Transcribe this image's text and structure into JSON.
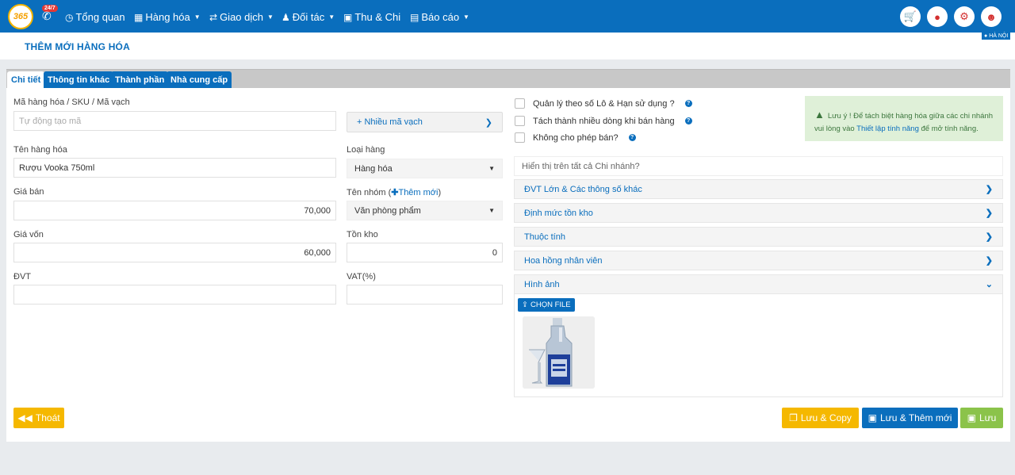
{
  "nav": {
    "logo_text": "365",
    "badge_text": "24/7",
    "items": [
      {
        "label": "Tổng quan",
        "icon": "dashboard-icon"
      },
      {
        "label": "Hàng hóa",
        "icon": "cubes-icon"
      },
      {
        "label": "Giao dịch",
        "icon": "exchange-icon"
      },
      {
        "label": "Đối tác",
        "icon": "users-icon"
      },
      {
        "label": "Thu & Chi",
        "icon": "money-icon"
      },
      {
        "label": "Báo cáo",
        "icon": "bar-chart-icon"
      }
    ],
    "right_icons": [
      "cart-icon",
      "map-marker-icon",
      "gear-icon",
      "user-icon"
    ]
  },
  "page": {
    "title": "THÊM MỚI HÀNG HÓA",
    "branch": "HÀ NỘI"
  },
  "tabs": [
    "Chi tiết",
    "Thông tin khác",
    "Thành phần",
    "Nhà cung cấp"
  ],
  "form": {
    "sku_label": "Mã hàng hóa / SKU / Mã vạch",
    "sku_placeholder": "Tự động tạo mã",
    "multi_barcode": "+ Nhiều mã vạch",
    "name_label": "Tên hàng hóa",
    "name_value": "Rượu Vooka 750ml",
    "type_label": "Loại hàng",
    "type_value": "Hàng hóa",
    "price_label": "Giá bán",
    "price_value": "70,000",
    "group_label": "Tên nhóm (",
    "group_add": "Thêm mới",
    "group_label_end": ")",
    "group_value": "Văn phòng phẩm",
    "cost_label": "Giá vốn",
    "cost_value": "60,000",
    "stock_label": "Tồn kho",
    "stock_value": "0",
    "unit_label": "ĐVT",
    "unit_value": "",
    "vat_label": "VAT(%)",
    "vat_value": ""
  },
  "options": {
    "lot": "Quản lý theo số Lô & Hạn sử dụng ?",
    "split": "Tách thành nhiều dòng khi bán hàng",
    "no_sell": "Không cho phép bán?",
    "show_all": "Hiển thị trên tất cả Chi nhánh?"
  },
  "note": {
    "text1": "Lưu ý ! Để tách biệt hàng hóa giữa các chi nhánh",
    "text2": "vui lòng vào ",
    "link": "Thiết lập tính năng",
    "text3": " để mở tính năng."
  },
  "accordion": [
    "ĐVT Lớn & Các thông số khác",
    "Định mức tồn kho",
    "Thuộc tính",
    "Hoa hồng nhân viên",
    "Hình ảnh"
  ],
  "image_section": {
    "choose_file": "CHỌN FILE"
  },
  "actions": {
    "exit": "Thoát",
    "save_copy": "Lưu & Copy",
    "save_new": "Lưu & Thêm mới",
    "save": "Lưu"
  },
  "colors": {
    "primary": "#0a6ebd",
    "warning": "#f5b800",
    "success": "#8bc34a",
    "danger": "#d32f2f"
  }
}
